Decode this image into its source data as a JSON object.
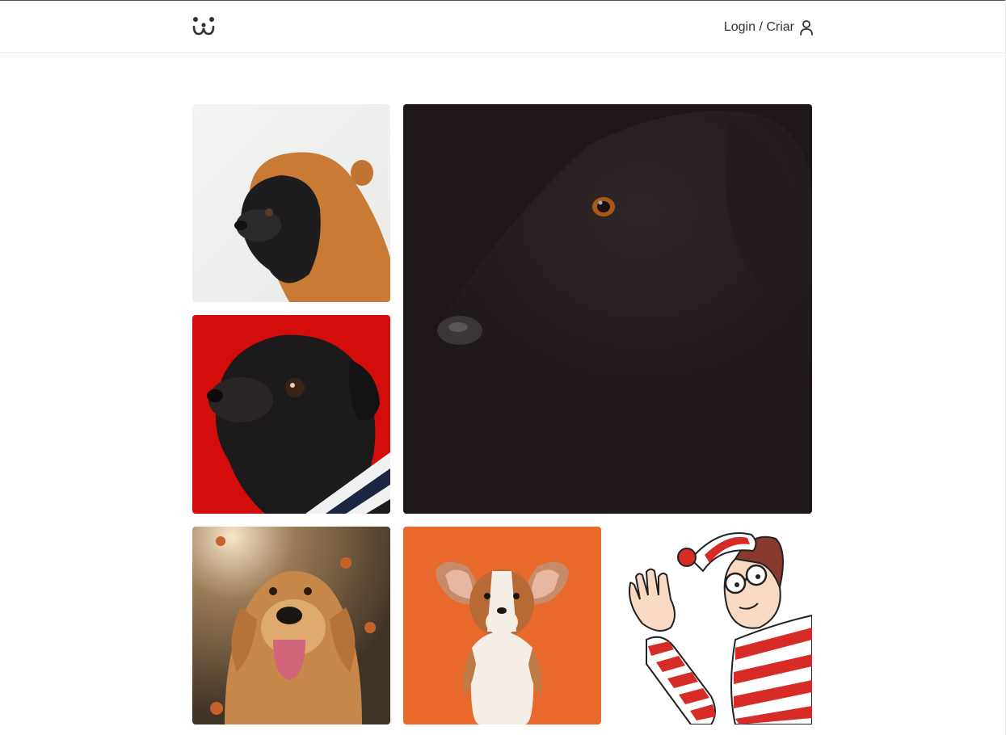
{
  "header": {
    "logo_icon": "dog-face-logo-icon",
    "login_label": "Login / Criar",
    "user_icon": "user-icon"
  },
  "feed": {
    "photos": [
      {
        "subject": "pug-in-orange-hood",
        "background": "#f2f2f0"
      },
      {
        "subject": "black-dog-closeup",
        "background": "#1f1616"
      },
      {
        "subject": "pug-on-red",
        "background": "#d40f0f"
      },
      {
        "subject": "golden-retriever-autumn",
        "background": "#8b6a45"
      },
      {
        "subject": "corgi-puppy-on-orange",
        "background": "#e9692a"
      },
      {
        "subject": "waldo-cartoon",
        "background": "#ffffff"
      }
    ]
  },
  "colors": {
    "text": "#333333",
    "border": "#e8e8e8"
  }
}
